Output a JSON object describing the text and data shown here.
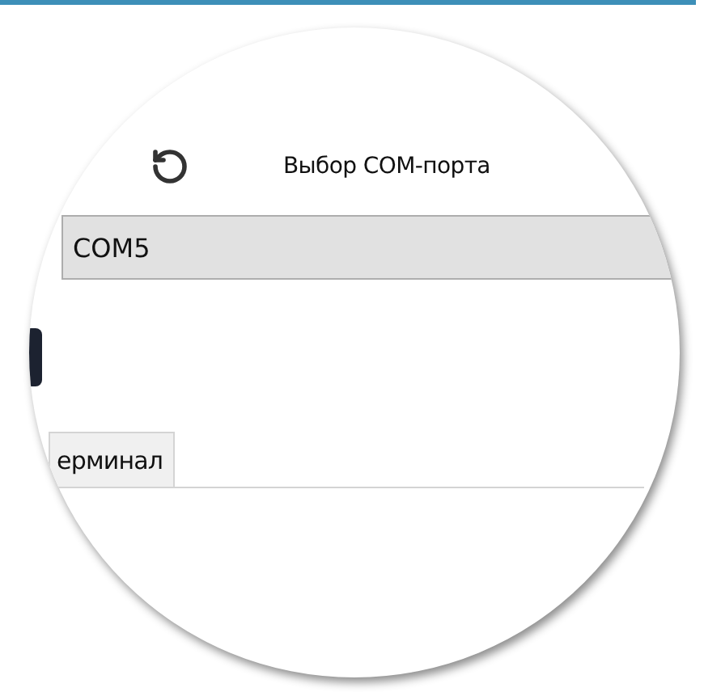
{
  "toolbar": {
    "label": "Выбор COM-порта"
  },
  "port_field": {
    "value": "COM5"
  },
  "tabs": [
    {
      "label": "ерминал",
      "selected": false
    }
  ]
}
